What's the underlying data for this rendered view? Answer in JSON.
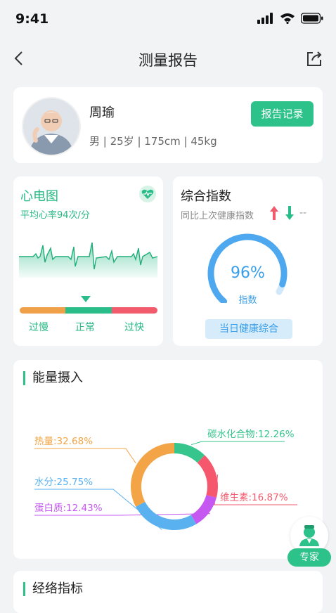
{
  "status": {
    "time": "9:41"
  },
  "nav": {
    "title": "测量报告"
  },
  "profile": {
    "name": "周瑜",
    "info": "男 | 25岁 | 175cm | 45kg",
    "record_button": "报告记录"
  },
  "ecg": {
    "title": "心电图",
    "subtitle": "平均心率94次/分",
    "labels": [
      "过慢",
      "正常",
      "过快"
    ],
    "colors": [
      "#f1a04a",
      "#2bbd89",
      "#f15b6c"
    ]
  },
  "score": {
    "title": "综合指数",
    "compare": "同比上次健康指数",
    "dash": "--",
    "percent": "96%",
    "percent_value": 96,
    "unit": "指数",
    "button": "当日健康综合"
  },
  "energy": {
    "title": "能量摄入",
    "chart_data": {
      "type": "pie",
      "categories": [
        "碳水化合物",
        "维生素",
        "蛋白质",
        "水分",
        "热量"
      ],
      "values": [
        12.26,
        16.87,
        12.43,
        25.75,
        32.68
      ],
      "labels": [
        "碳水化合物:12.26%",
        "维生素:16.87%",
        "蛋白质:12.43%",
        "水分:25.75%",
        "热量:32.68%"
      ],
      "colors": [
        "#36c58d",
        "#f5586c",
        "#c458f0",
        "#5ab1f0",
        "#f3a446"
      ]
    }
  },
  "meridian": {
    "title": "经络指标"
  },
  "expert": {
    "label": "专家"
  }
}
